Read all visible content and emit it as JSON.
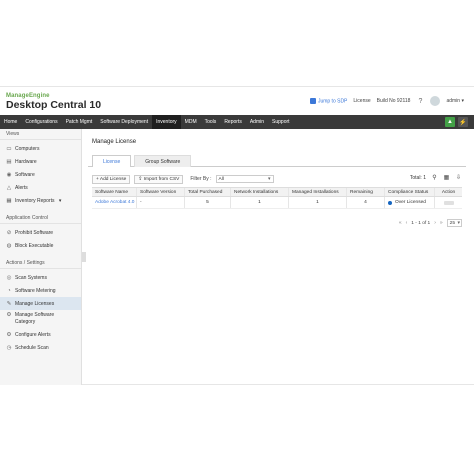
{
  "header": {
    "logo_brand": "ManageEngine",
    "product": "Desktop Central 10",
    "jump_sdp": "Jump to SDP",
    "license": "License",
    "build": "Build No 92118",
    "help_icon": "?",
    "user": "admin"
  },
  "nav": {
    "items": [
      "Home",
      "Configurations",
      "Patch Mgmt",
      "Software Deployment",
      "Inventory",
      "MDM",
      "Tools",
      "Reports",
      "Admin",
      "Support"
    ]
  },
  "sidebar": {
    "views_title": "Views",
    "views": [
      "Computers",
      "Hardware",
      "Software",
      "Alerts",
      "Inventory Reports"
    ],
    "app_control_title": "Application Control",
    "app_control": [
      "Prohibit Software",
      "Block Executable"
    ],
    "actions_title": "Actions / Settings",
    "actions": [
      "Scan Systems",
      "Software Metering",
      "Manage Licenses",
      "Manage Software Category",
      "Configure Alerts",
      "Schedule Scan"
    ]
  },
  "main": {
    "title": "Manage License",
    "tabs": [
      "License",
      "Group Software"
    ],
    "toolbar": {
      "add": "+ Add License",
      "import": "Import from CSV",
      "filter_label": "Filter By :",
      "filter_value": "All",
      "total": "Total: 1"
    },
    "table": {
      "headers": [
        "Software Name",
        "Software Version",
        "Total Purchased",
        "Network Installations",
        "Managed Installations",
        "Remaining",
        "Compliance Status",
        "Action"
      ],
      "rows": [
        [
          "Adobe Acrobat 4.0",
          "-",
          "5",
          "1",
          "1",
          "4",
          "Over Licensed",
          ""
        ]
      ]
    },
    "pager": {
      "range": "1 - 1 of 1",
      "per_page": "25"
    }
  },
  "colors": {
    "nav_bg": "#3a3a3a",
    "accent": "#3c78d8",
    "green": "#43a047"
  }
}
